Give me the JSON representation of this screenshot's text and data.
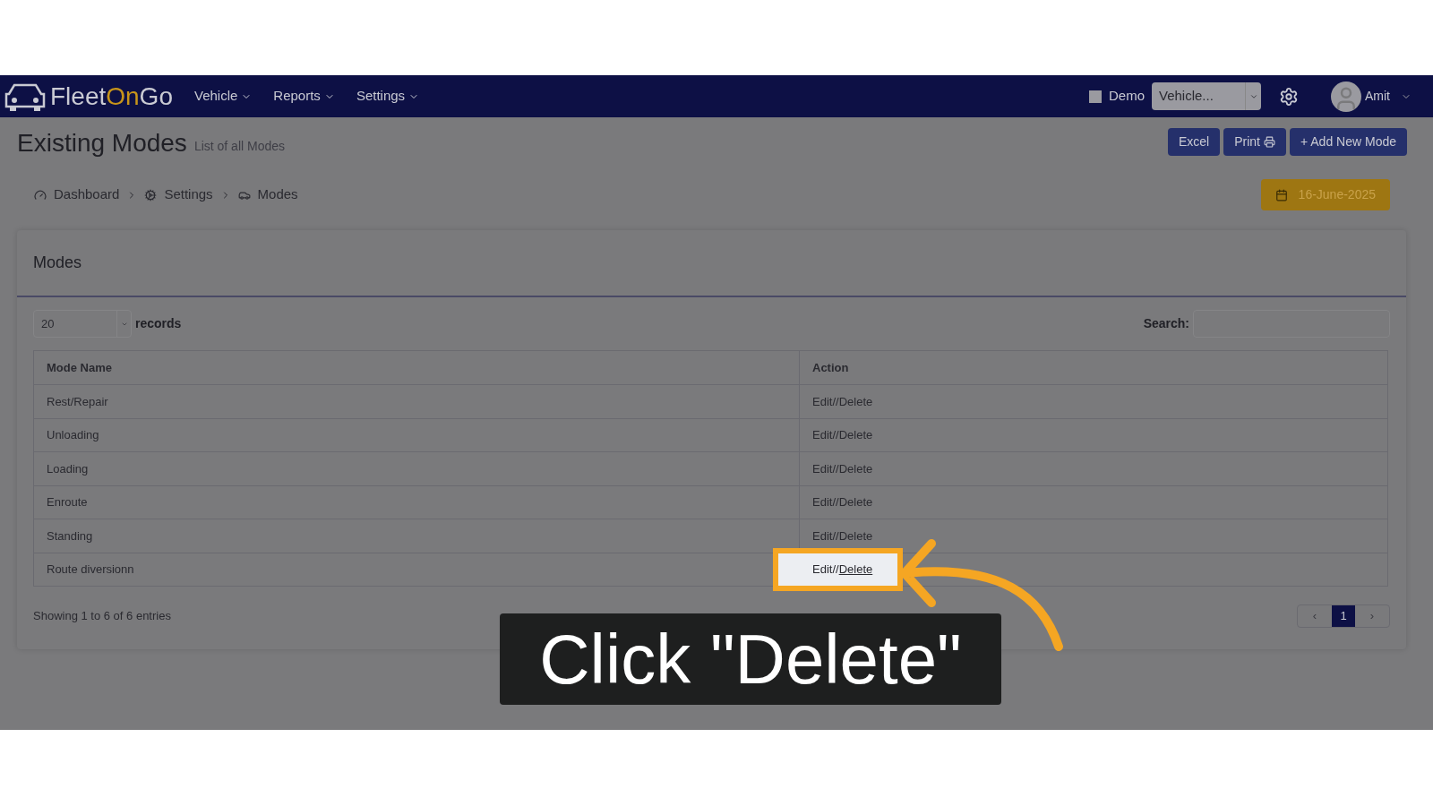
{
  "navbar": {
    "logo": [
      {
        "text": "Fleet",
        "color": "#c9cad3"
      },
      {
        "text": "On",
        "color": "#c8951a"
      },
      {
        "text": "Go",
        "color": "#c9cad3"
      }
    ],
    "menus": [
      "Vehicle",
      "Reports",
      "Settings"
    ],
    "demo": {
      "label": "Demo",
      "checked": false
    },
    "vehicle_select": {
      "value": "Vehicle..."
    },
    "user": {
      "name": "Amit"
    }
  },
  "header": {
    "title": "Existing Modes",
    "subtitle": "List of all Modes",
    "buttons": [
      {
        "label": "Excel",
        "kind": "plain"
      },
      {
        "label": "Print",
        "kind": "print"
      },
      {
        "label": "+ Add New Mode",
        "kind": "plain"
      }
    ]
  },
  "breadcrumb": [
    {
      "label": "Dashboard",
      "kind": "dashboard"
    },
    {
      "label": "Settings",
      "kind": "settings"
    },
    {
      "label": "Modes",
      "kind": "modes"
    }
  ],
  "date_button": {
    "label": "16-June-2025"
  },
  "panel": {
    "title": "Modes",
    "page_length": "20",
    "records_label": "records",
    "search_label": "Search:",
    "table": {
      "columns": [
        "Mode Name",
        "Action"
      ],
      "rows": [
        {
          "name": "Rest/Repair",
          "edit": "Edit",
          "separator": "//",
          "delete": "Delete",
          "highlighted": false
        },
        {
          "name": "Unloading",
          "edit": "Edit",
          "separator": "//",
          "delete": "Delete",
          "highlighted": false
        },
        {
          "name": "Loading",
          "edit": "Edit",
          "separator": "//",
          "delete": "Delete",
          "highlighted": false
        },
        {
          "name": "Enroute",
          "edit": "Edit",
          "separator": "//",
          "delete": "Delete",
          "highlighted": false
        },
        {
          "name": "Standing",
          "edit": "Edit",
          "separator": "//",
          "delete": "Delete",
          "highlighted": false
        },
        {
          "name": "Route diversionn",
          "edit": "Edit",
          "separator": "//",
          "delete": "Delete",
          "highlighted": true
        }
      ]
    },
    "info": "Showing 1 to 6 of 6 entries",
    "pagination": [
      {
        "label": "‹",
        "selected": false
      },
      {
        "label": "1",
        "selected": true
      },
      {
        "label": "›",
        "selected": false
      }
    ]
  },
  "caption": "Click \"Delete\""
}
